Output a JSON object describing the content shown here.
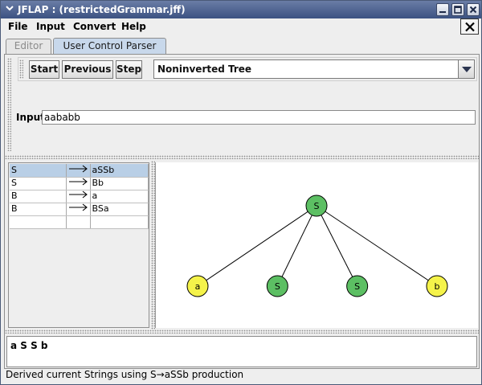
{
  "window": {
    "title": "JFLAP : (restrictedGrammar.jff)"
  },
  "menu": {
    "items": [
      "File",
      "Input",
      "Convert",
      "Help"
    ]
  },
  "tabs": [
    {
      "label": "Editor",
      "selected": false
    },
    {
      "label": "User Control Parser",
      "selected": true
    }
  ],
  "toolbar": {
    "start_label": "Start",
    "previous_label": "Previous",
    "step_label": "Step",
    "tree_mode": "Noninverted Tree"
  },
  "input": {
    "label": "Input",
    "value": "aababb"
  },
  "grammar": {
    "rows": [
      {
        "lhs": "S",
        "rhs": "aSSb",
        "selected": true
      },
      {
        "lhs": "S",
        "rhs": "Bb",
        "selected": false
      },
      {
        "lhs": "B",
        "rhs": "a",
        "selected": false
      },
      {
        "lhs": "B",
        "rhs": "BSa",
        "selected": false
      },
      {
        "lhs": "",
        "rhs": "",
        "selected": false
      }
    ]
  },
  "tree": {
    "root": {
      "label": "S",
      "kind": "variable"
    },
    "children": [
      {
        "label": "a",
        "kind": "terminal"
      },
      {
        "label": "S",
        "kind": "variable"
      },
      {
        "label": "S",
        "kind": "variable"
      },
      {
        "label": "b",
        "kind": "terminal"
      }
    ]
  },
  "derivation": {
    "text": "a S S b"
  },
  "status": {
    "text": "Derived current Strings using S→aSSb production"
  },
  "colors": {
    "variable_node": "#5cbf63",
    "terminal_node": "#f5f34a",
    "title_bar": "#3c5282",
    "selected_row": "#b9cfe6",
    "active_tab": "#c8d8eb"
  }
}
